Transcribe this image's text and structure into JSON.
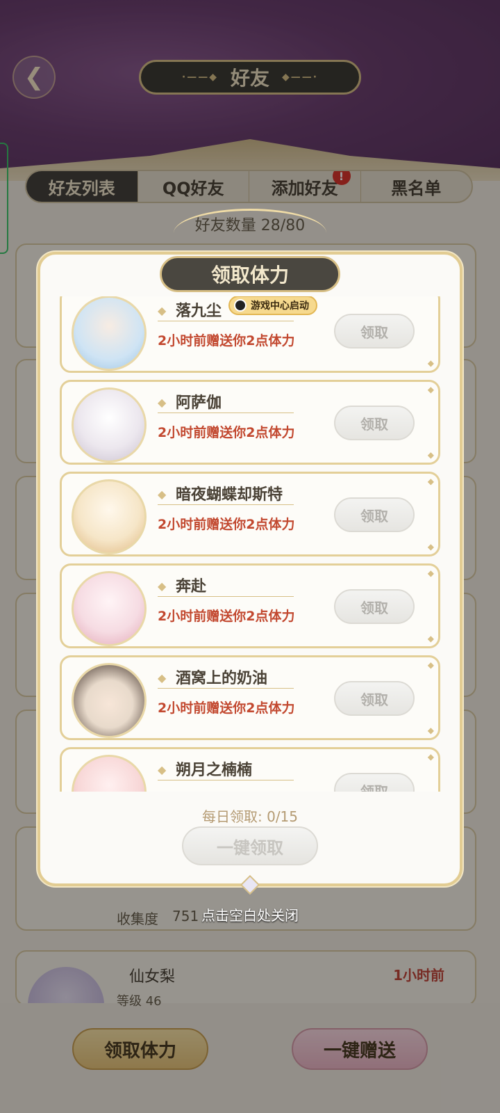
{
  "header": {
    "title": "好友"
  },
  "tabs": [
    {
      "label": "好友列表",
      "active": true
    },
    {
      "label": "QQ好友"
    },
    {
      "label": "添加好友",
      "alert": "!"
    },
    {
      "label": "黑名单"
    }
  ],
  "friend_count": {
    "label": "好友数量",
    "value": "28/80"
  },
  "background_list": {
    "visible_row": {
      "name": "仙女梨",
      "time": "1小时前",
      "level_label": "等级",
      "level_value": "46"
    },
    "collect_label": "收集度",
    "collect_value": "751"
  },
  "bottom_buttons": {
    "claim": "领取体力",
    "gift": "一键赠送"
  },
  "close_hint": "点击空白处关闭",
  "modal": {
    "title": "领取体力",
    "qq_badge": "游戏中心启动",
    "claim_label": "领取",
    "rows": [
      {
        "name": "落九尘",
        "message": "2小时前赠送你2点体力",
        "avatar_color": "#cfe4f4"
      },
      {
        "name": "阿萨伽",
        "message": "2小时前赠送你2点体力",
        "avatar_color": "#ece7ee"
      },
      {
        "name": "暗夜蝴蝶却斯特",
        "message": "2小时前赠送你2点体力",
        "avatar_color": "#f6e6c8"
      },
      {
        "name": "奔赴",
        "message": "2小时前赠送你2点体力",
        "avatar_color": "#f6dce3"
      },
      {
        "name": "酒窝上的奶油",
        "message": "2小时前赠送你2点体力",
        "avatar_color": "#e8dacb"
      },
      {
        "name": "朔月之楠楠",
        "message": "",
        "avatar_color": "#f8d8d8"
      }
    ],
    "daily_label": "每日领取:",
    "daily_value": "0/15",
    "claim_all": "一键领取"
  }
}
